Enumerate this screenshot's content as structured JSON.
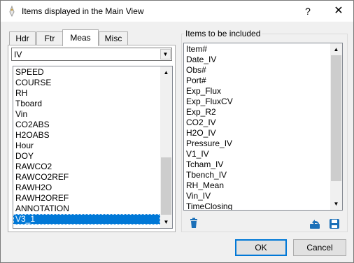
{
  "window": {
    "title": "Items displayed in the Main View",
    "help_label": "?",
    "close_label": "✕",
    "icon": "app-icon"
  },
  "tabs": [
    {
      "label": "Hdr"
    },
    {
      "label": "Ftr"
    },
    {
      "label": "Meas",
      "active": true
    },
    {
      "label": "Misc"
    }
  ],
  "combo": {
    "value": "IV"
  },
  "available_items": [
    "SPEED",
    "COURSE",
    "RH",
    "Tboard",
    "Vin",
    "CO2ABS",
    "H2OABS",
    "Hour",
    "DOY",
    "RAWCO2",
    "RAWCO2REF",
    "RAWH2O",
    "RAWH2OREF",
    "ANNOTATION",
    "V3_1"
  ],
  "available_selected": "V3_1",
  "included": {
    "group_label": "Items to be included",
    "items": [
      "Item#",
      "Date_IV",
      "Obs#",
      "Port#",
      "Exp_Flux",
      "Exp_FluxCV",
      "Exp_R2",
      "CO2_IV",
      "H2O_IV",
      "Pressure_IV",
      "V1_IV",
      "Tcham_IV",
      "Tbench_IV",
      "RH_Mean",
      "Vin_IV",
      "TimeClosing"
    ]
  },
  "tools": {
    "delete_icon": "trash-icon",
    "undo_icon": "undo-icon",
    "save_icon": "save-icon"
  },
  "buttons": {
    "ok": "OK",
    "cancel": "Cancel"
  },
  "colors": {
    "selection": "#0078d7",
    "tool_icon": "#1a6fb8"
  }
}
